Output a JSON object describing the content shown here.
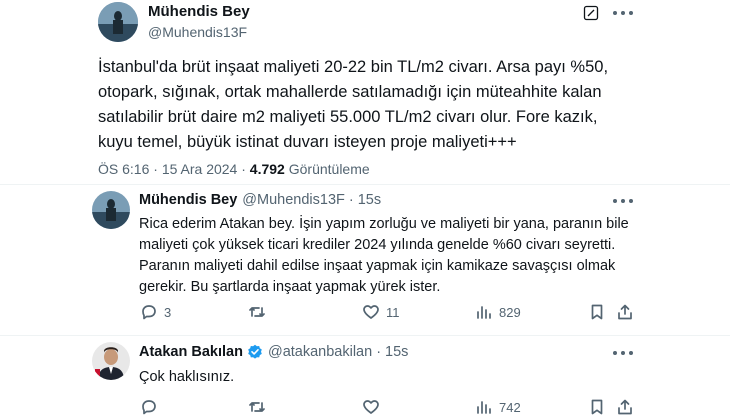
{
  "main_tweet": {
    "display_name": "Mühendis Bey",
    "handle": "@Muhendis13F",
    "lines": [
      "İstanbul'da brüt inşaat maliyeti 20-22 bin TL/m2 civarı. Arsa payı %50,",
      "otopark, sığınak, ortak mahallerde satılamadığı için müteahhite kalan",
      "satılabilir brüt daire m2 maliyeti 55.000 TL/m2 civarı olur. Fore kazık,",
      "kuyu temel, büyük istinat duvarı isteyen proje maliyeti+++"
    ],
    "time": "ÖS 6:16",
    "date_sep": "·",
    "date": "15 Ara 2024",
    "views_sep": "·",
    "views": "4.792",
    "views_label": "Görüntüleme",
    "edit_icon": "edit-icon"
  },
  "reply_one": {
    "display_name": "Mühendis Bey",
    "handle": "@Muhendis13F",
    "time_sep": "·",
    "rel_time": "15s",
    "lines": [
      "Rica ederim Atakan bey. İşin yapım zorluğu ve maliyeti bir yana, paranın bile",
      "maliyeti çok yüksek ticari krediler 2024 yılında genelde %60 civarı seyretti.",
      "Paranın maliyeti dahil edilse inşaat yapmak için kamikaze savaşçısı olmak",
      "gerekir. Bu şartlarda inşaat yapmak yürek ister."
    ],
    "replies": "3",
    "retweets": "",
    "likes": "11",
    "views": "829"
  },
  "reply_two": {
    "display_name": "Atakan Bakılan",
    "handle": "@atakanbakilan",
    "time_sep": "·",
    "rel_time": "15s",
    "verified_color": "#1d9bf0",
    "text": "Çok haklısınız.",
    "replies": "",
    "retweets": "",
    "likes": "",
    "views": "742"
  },
  "colors": {
    "text": "#0f1419",
    "secondary": "#536471",
    "divider": "#eff3f4",
    "accent": "#1d9bf0"
  }
}
